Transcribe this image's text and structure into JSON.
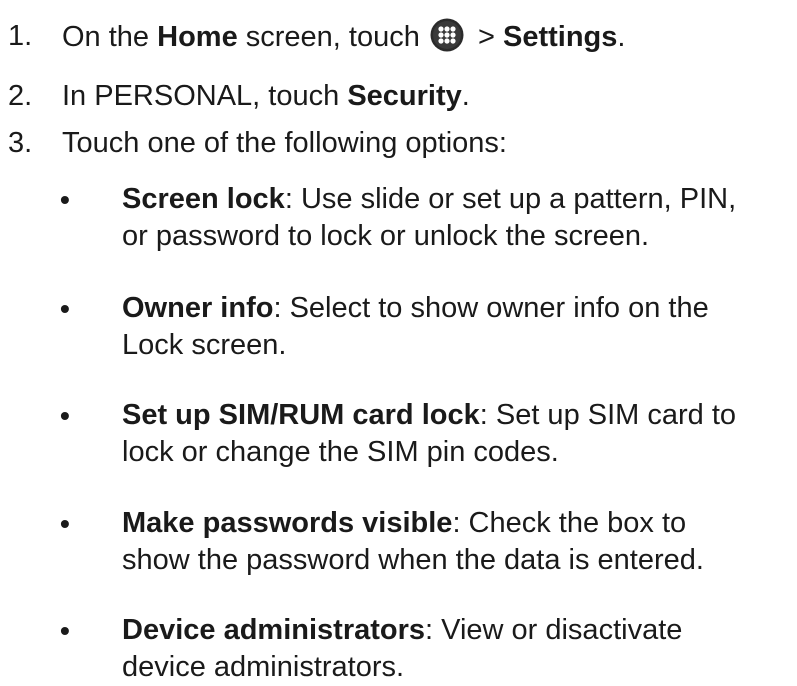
{
  "steps": [
    {
      "number": "1.",
      "pre": "On the ",
      "bold1": "Home",
      "mid": " screen, touch ",
      "icon": "apps-grid-icon",
      "post": " > ",
      "bold2": "Settings",
      "end": "."
    },
    {
      "number": "2.",
      "pre": "In PERSONAL, touch ",
      "bold": "Security",
      "end": "."
    },
    {
      "number": "3.",
      "text": "Touch one of the following options:"
    }
  ],
  "options": [
    {
      "title": "Screen lock",
      "desc_line1": ": Use slide or set up a pattern, PIN,",
      "desc_line2": "or password to lock or unlock the screen."
    },
    {
      "title": "Owner info",
      "desc_line1": ": Select to show owner info on the",
      "desc_line2": "Lock screen."
    },
    {
      "title": "Set up SIM/RUM card lock",
      "desc_line1": ": Set up SIM card to",
      "desc_line2": "lock or change the SIM pin codes."
    },
    {
      "title": "Make passwords visible",
      "desc_line1": ": Check the box to",
      "desc_line2": "show the password when the data is entered."
    },
    {
      "title": "Device administrators",
      "desc_line1": ": View or disactivate",
      "desc_line2": "device administrators."
    }
  ],
  "bullet_glyph": "•",
  "colors": {
    "text": "#1a1a1a",
    "icon_bg": "#2b2b2b",
    "icon_dots": "#ffffff"
  }
}
